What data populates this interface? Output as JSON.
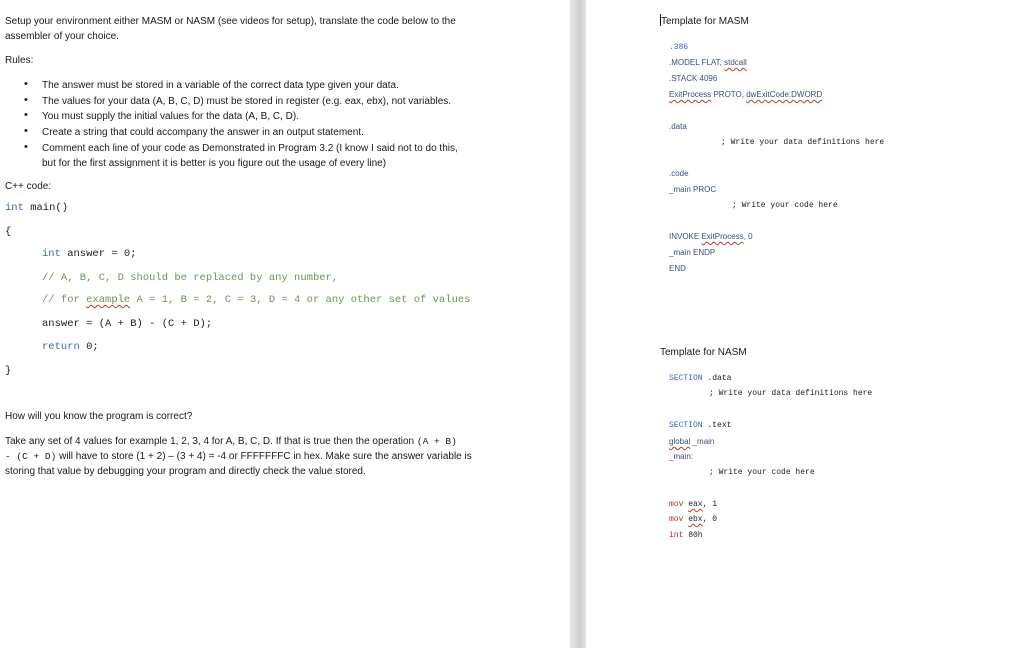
{
  "left": {
    "intro_line1": "Setup your environment either MASM or NASM (see videos for setup), translate the code below to the",
    "intro_line2": "assembler of your choice.",
    "rules_heading": "Rules:",
    "rules": [
      [
        "The answer must be stored in a variable of the correct data type given your data."
      ],
      [
        "The values for your data (A, B, C, D) must be stored in register (e.g. eax, ebx), not variables."
      ],
      [
        "You must supply the initial values for the data (A, B, C, D)."
      ],
      [
        "Create a string that could accompany the answer in an output statement."
      ],
      [
        "Comment each line of your code as Demonstrated in Program 3.2 (I know I said not to do this,",
        "but for the first assignment it is better is you figure out the usage of every line)"
      ]
    ],
    "cpp_heading": "C++ code:",
    "code": {
      "main_kw": "int",
      "main_rest": " main()",
      "open_brace": "{",
      "l1_kw": "int",
      "l1_rest": " answer = 0;",
      "l2": "// A, B, C, D should be replaced by any number,",
      "l3_a": "// for ",
      "l3_b": "example",
      "l3_c": " A = 1, B = 2, C = 3, D = 4 or any other set of values",
      "l4": "answer = (A + B) - (C + D);",
      "l5_kw": "return",
      "l5_rest": " 0;",
      "close_brace": "}"
    },
    "question": "How will you know the program is correct?",
    "answer_a1": "Take any set of 4 values for example 1, 2, 3, 4 for A, B, C, D. If that is true then the operation ",
    "answer_m1": "(A + B)",
    "answer_m2": "- (C + D)",
    "answer_a2": " will have to store (1 + 2) – (3 + 4) = -4 or FFFFFFFC in hex. Make sure the answer variable is",
    "answer_a3": "storing that value by debugging your program and directly check the value stored."
  },
  "right": {
    "masm_title": "Template for MASM",
    "masm": {
      "l1": ".386",
      "l2a": ".MODEL FLAT, ",
      "l2b": "stdcall",
      "l3": ".STACK 4096",
      "l4a": "ExitProcess",
      "l4b": " PROTO, ",
      "l4c": "dwExitCode:DWORD",
      "data": ".data",
      "data_comment": "; Write your data definitions here",
      "code": ".code",
      "main_proc": "_main PROC",
      "code_comment": "; Write your code here",
      "invoke_a": "INVOKE ",
      "invoke_b": "ExitProcess",
      "invoke_c": ", 0",
      "endp": "_main ENDP",
      "end": "END"
    },
    "nasm_title": "Template for NASM",
    "nasm": {
      "section_data_kw": "SECTION",
      "section_data_rest": " .data",
      "data_comment": "; Write your data definitions here",
      "section_text_kw": "SECTION",
      "section_text_rest": " .text",
      "global_a": "global",
      "global_b": " _main",
      "main_label": "_main:",
      "code_comment": "; Write your code here",
      "mov1_a": "mov ",
      "mov1_b": "eax",
      "mov1_c": ", 1",
      "mov2_a": "mov ",
      "mov2_b": "ebx",
      "mov2_c": ", 0",
      "int_a": "int",
      "int_b": " 80h"
    }
  }
}
